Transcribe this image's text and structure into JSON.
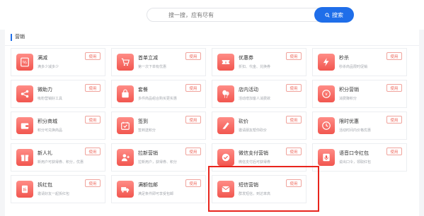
{
  "search": {
    "placeholder": "搜一搜，应有尽有",
    "button_label": "搜索"
  },
  "section": {
    "title": "营销"
  },
  "tools": [
    {
      "name": "满减",
      "desc": "满多少减多少",
      "use": "使用",
      "icon": "percent-icon"
    },
    {
      "name": "首单立减",
      "desc": "第一次下单有优惠",
      "use": "使用",
      "icon": "cart-icon"
    },
    {
      "name": "优惠券",
      "desc": "折扣、代金、兑换券",
      "use": "使用",
      "icon": "ticket-icon"
    },
    {
      "name": "秒杀",
      "desc": "秒杀商品限时促销",
      "use": "使用",
      "icon": "lightning-icon"
    },
    {
      "name": "微助力",
      "desc": "吸粉营销好工具",
      "use": "使用",
      "icon": "share-icon"
    },
    {
      "name": "套餐",
      "desc": "多件商品组合购买更实惠",
      "use": "使用",
      "icon": "bag-icon"
    },
    {
      "name": "店内活动",
      "desc": "活动增加客人消费欲",
      "use": "使用",
      "icon": "balloon-icon"
    },
    {
      "name": "积分营销",
      "desc": "消费赚积分",
      "use": "使用",
      "icon": "coin-icon"
    },
    {
      "name": "积分商城",
      "desc": "积分可兑换商品",
      "use": "使用",
      "icon": "wallet-icon"
    },
    {
      "name": "签到",
      "desc": "签到送积分",
      "use": "使用",
      "icon": "calendar-check-icon"
    },
    {
      "name": "砍价",
      "desc": "邀请朋友帮你砍价",
      "use": "使用",
      "icon": "knife-icon"
    },
    {
      "name": "限时优惠",
      "desc": "活动时间内价格优惠",
      "use": "使用",
      "icon": "clock-icon"
    },
    {
      "name": "新人礼",
      "desc": "新用户可获得券、积分，优惠",
      "use": "使用",
      "icon": "gift-icon"
    },
    {
      "name": "拉新营销",
      "desc": "拉新用户，获得券、积分",
      "use": "使用",
      "icon": "user-plus-icon"
    },
    {
      "name": "微信支付营销",
      "desc": "微信支付后可获得券",
      "use": "使用",
      "icon": "check-circle-icon"
    },
    {
      "name": "语音口令红包",
      "desc": "说出口令，领取红包",
      "use": "使用",
      "icon": "mic-envelope-icon"
    },
    {
      "name": "拆红包",
      "desc": "邀请好友一起拆红包",
      "use": "使用",
      "icon": "red-packet-icon"
    },
    {
      "name": "满额包邮",
      "desc": "满足条件即可享受包邮",
      "use": "使用",
      "icon": "truck-icon"
    },
    {
      "name": "短信营销",
      "desc": "群发短信，到达率高",
      "use": "使用",
      "icon": "sms-icon"
    }
  ],
  "colors": {
    "accent": "#1f6ee9",
    "icon_tile": "#f1564f",
    "highlight_border": "#e8251d"
  }
}
